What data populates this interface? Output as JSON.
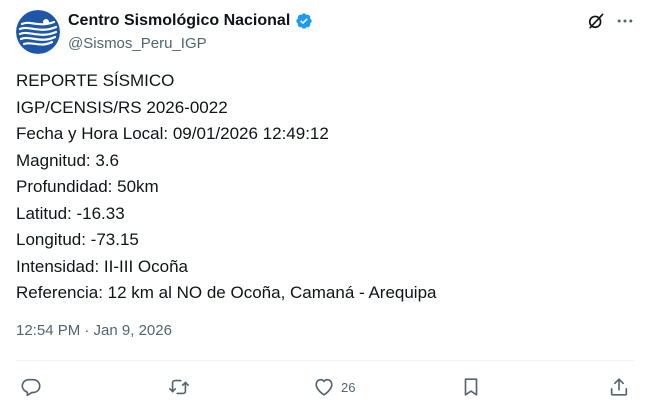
{
  "author": {
    "display_name": "Centro Sismológico Nacional",
    "handle": "@Sismos_Peru_IGP",
    "verified": true
  },
  "tweet": {
    "lines": [
      "REPORTE SÍSMICO",
      "IGP/CENSIS/RS 2026-0022",
      "Fecha y Hora Local: 09/01/2026 12:49:12",
      "Magnitud: 3.6",
      "Profundidad: 50km",
      "Latitud: -16.33",
      "Longitud: -73.15",
      "Intensidad: II-III Ocoña",
      "Referencia: 12 km al NO de Ocoña, Camaná - Arequipa"
    ],
    "timestamp": "12:54 PM · Jan 9, 2026"
  },
  "actions": {
    "like_count": "26"
  },
  "icons": {
    "avatar": "igp-logo-icon",
    "verified": "verified-badge-icon",
    "grok": "grok-icon",
    "more": "more-icon",
    "reply": "reply-icon",
    "repost": "repost-icon",
    "like": "heart-icon",
    "bookmark": "bookmark-icon",
    "share": "share-icon"
  },
  "colors": {
    "text": "#0f1419",
    "secondary": "#536471",
    "verified": "#1d9bf0",
    "avatar_blue": "#1f57a8"
  }
}
